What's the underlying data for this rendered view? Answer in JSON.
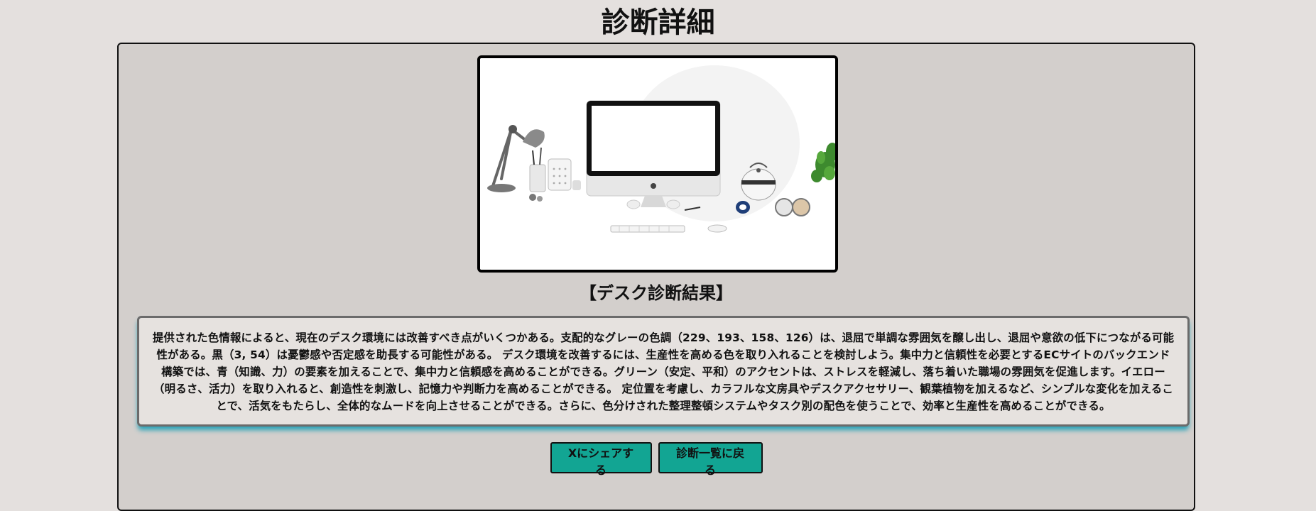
{
  "page": {
    "title": "診断詳細"
  },
  "result": {
    "heading": "【デスク診断結果】",
    "body": "提供された色情報によると、現在のデスク環境には改善すべき点がいくつかある。支配的なグレーの色調（229、193、158、126）は、退屈で単調な雰囲気を醸し出し、退屈や意欲の低下につながる可能性がある。黒（3, 54）は憂鬱感や否定感を助長する可能性がある。 デスク環境を改善するには、生産性を高める色を取り入れることを検討しよう。集中力と信頼性を必要とするECサイトのバックエンド構築では、青（知識、力）の要素を加えることで、集中力と信頼感を高めることができる。グリーン（安定、平和）のアクセントは、ストレスを軽減し、落ち着いた職場の雰囲気を促進します。イエロー（明るさ、活力）を取り入れると、創造性を刺激し、記憶力や判断力を高めることができる。 定位置を考慮し、カラフルな文房具やデスクアクセサリー、観葉植物を加えるなど、シンプルな変化を加えることで、活気をもたらし、全体的なムードを向上させることができる。さらに、色分けされた整理整頓システムやタスク別の配色を使うことで、効率と生産性を高めることができる。"
  },
  "actions": {
    "share_label": "Xにシェアする",
    "back_label": "診断一覧に戻る"
  },
  "colors": {
    "page_background": "#e4e0de",
    "card_background": "#d3cfcc",
    "button_accent": "#12a593",
    "result_glow": "#2aa3b8"
  }
}
